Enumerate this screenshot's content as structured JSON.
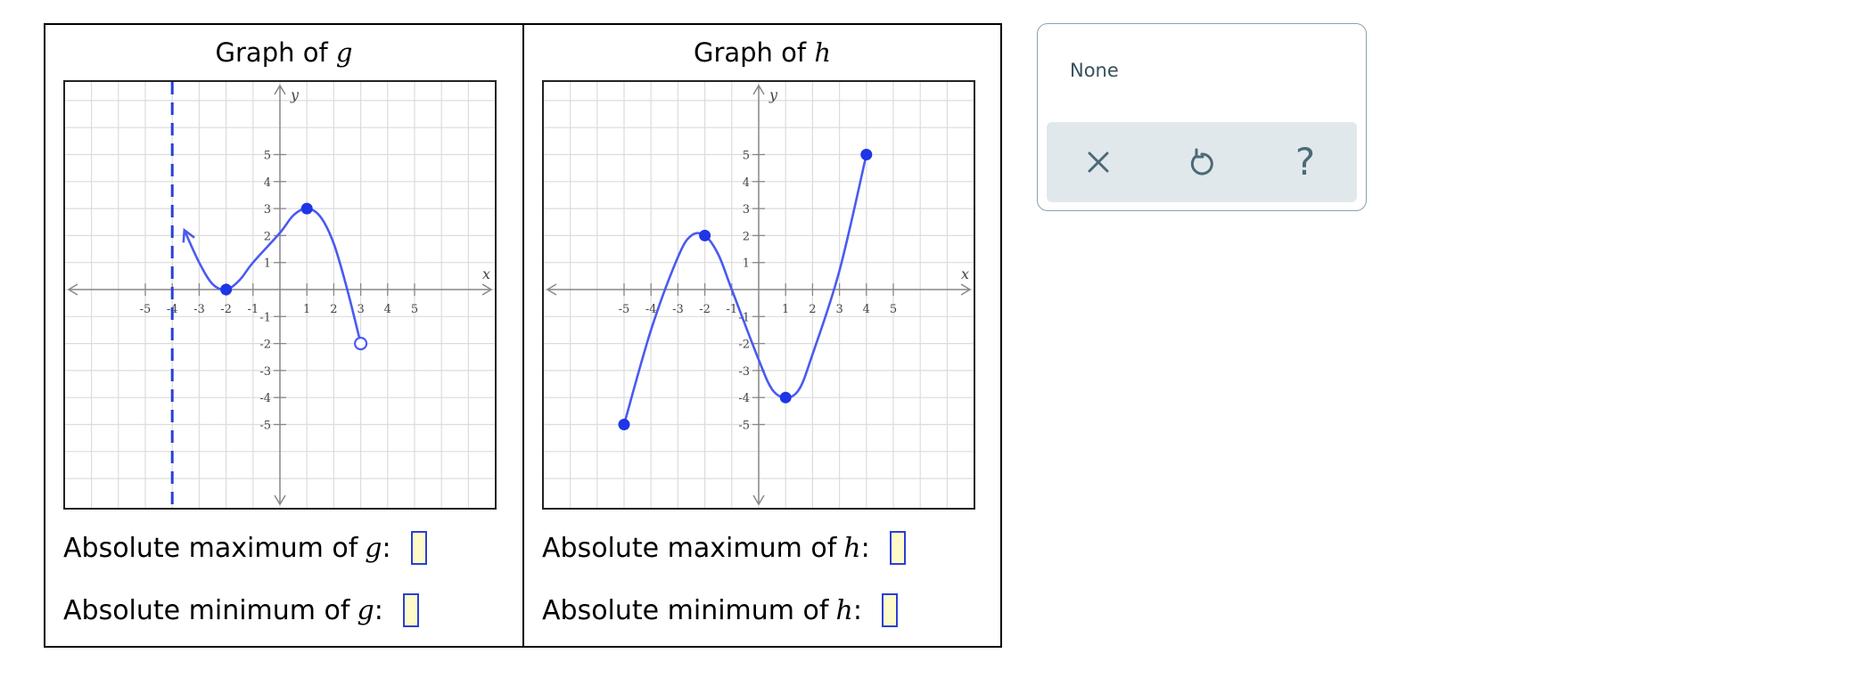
{
  "graph_g": {
    "title_prefix": "Graph of",
    "var": "g",
    "max_label": "Absolute maximum of",
    "min_label": "Absolute minimum of"
  },
  "graph_h": {
    "title_prefix": "Graph of",
    "var": "h",
    "max_label": "Absolute maximum of",
    "min_label": "Absolute minimum of"
  },
  "colon": ":",
  "panel": {
    "status": "None",
    "buttons": [
      "clear-icon",
      "undo-icon",
      "help-icon"
    ],
    "help_glyph": "?"
  },
  "colors": {
    "curve": "#4a5af0",
    "grid": "#dcdcdc",
    "axis": "#888888",
    "panel_bar": "#e1e8eb"
  },
  "chart_data": [
    {
      "type": "line",
      "title": "Graph of g",
      "xlabel": "x",
      "ylabel": "y",
      "xlim": [
        -6,
        6
      ],
      "ylim": [
        -6,
        6
      ],
      "x_ticks": [
        -5,
        -4,
        -3,
        -2,
        -1,
        1,
        2,
        3,
        4,
        5
      ],
      "y_ticks": [
        -5,
        -4,
        -3,
        -2,
        -1,
        1,
        2,
        3,
        4,
        5
      ],
      "grid": true,
      "asymptote_x": -4,
      "curve": [
        [
          -3.55,
          2.2
        ],
        [
          -3,
          1.0
        ],
        [
          -2.5,
          0.2
        ],
        [
          -2,
          0
        ],
        [
          -1.5,
          0.35
        ],
        [
          -1,
          1.0
        ],
        [
          0,
          2.1
        ],
        [
          0.5,
          2.75
        ],
        [
          1,
          3
        ],
        [
          1.5,
          2.7
        ],
        [
          2,
          1.7
        ],
        [
          2.5,
          0.0
        ],
        [
          3,
          -2
        ]
      ],
      "arrow_end": [
        -3.55,
        2.2
      ],
      "closed_points": [
        [
          -2,
          0
        ],
        [
          1,
          3
        ]
      ],
      "open_points": [
        [
          3,
          -2
        ]
      ]
    },
    {
      "type": "line",
      "title": "Graph of h",
      "xlabel": "x",
      "ylabel": "y",
      "xlim": [
        -6,
        6
      ],
      "ylim": [
        -6,
        6
      ],
      "x_ticks": [
        -5,
        -4,
        -3,
        -2,
        -1,
        1,
        2,
        3,
        4,
        5
      ],
      "y_ticks": [
        -5,
        -4,
        -3,
        -2,
        -1,
        1,
        2,
        3,
        4,
        5
      ],
      "grid": true,
      "curve": [
        [
          -5,
          -5
        ],
        [
          -4,
          -1.5
        ],
        [
          -3,
          1.2
        ],
        [
          -2.5,
          2.0
        ],
        [
          -2,
          2
        ],
        [
          -1.5,
          1.3
        ],
        [
          -1,
          0
        ],
        [
          0,
          -2.6
        ],
        [
          0.5,
          -3.7
        ],
        [
          1,
          -4
        ],
        [
          1.5,
          -3.7
        ],
        [
          2,
          -2.4
        ],
        [
          3,
          0.7
        ],
        [
          4,
          5
        ]
      ],
      "closed_points": [
        [
          -5,
          -5
        ],
        [
          -2,
          2
        ],
        [
          1,
          -4
        ],
        [
          4,
          5
        ]
      ],
      "open_points": []
    }
  ]
}
